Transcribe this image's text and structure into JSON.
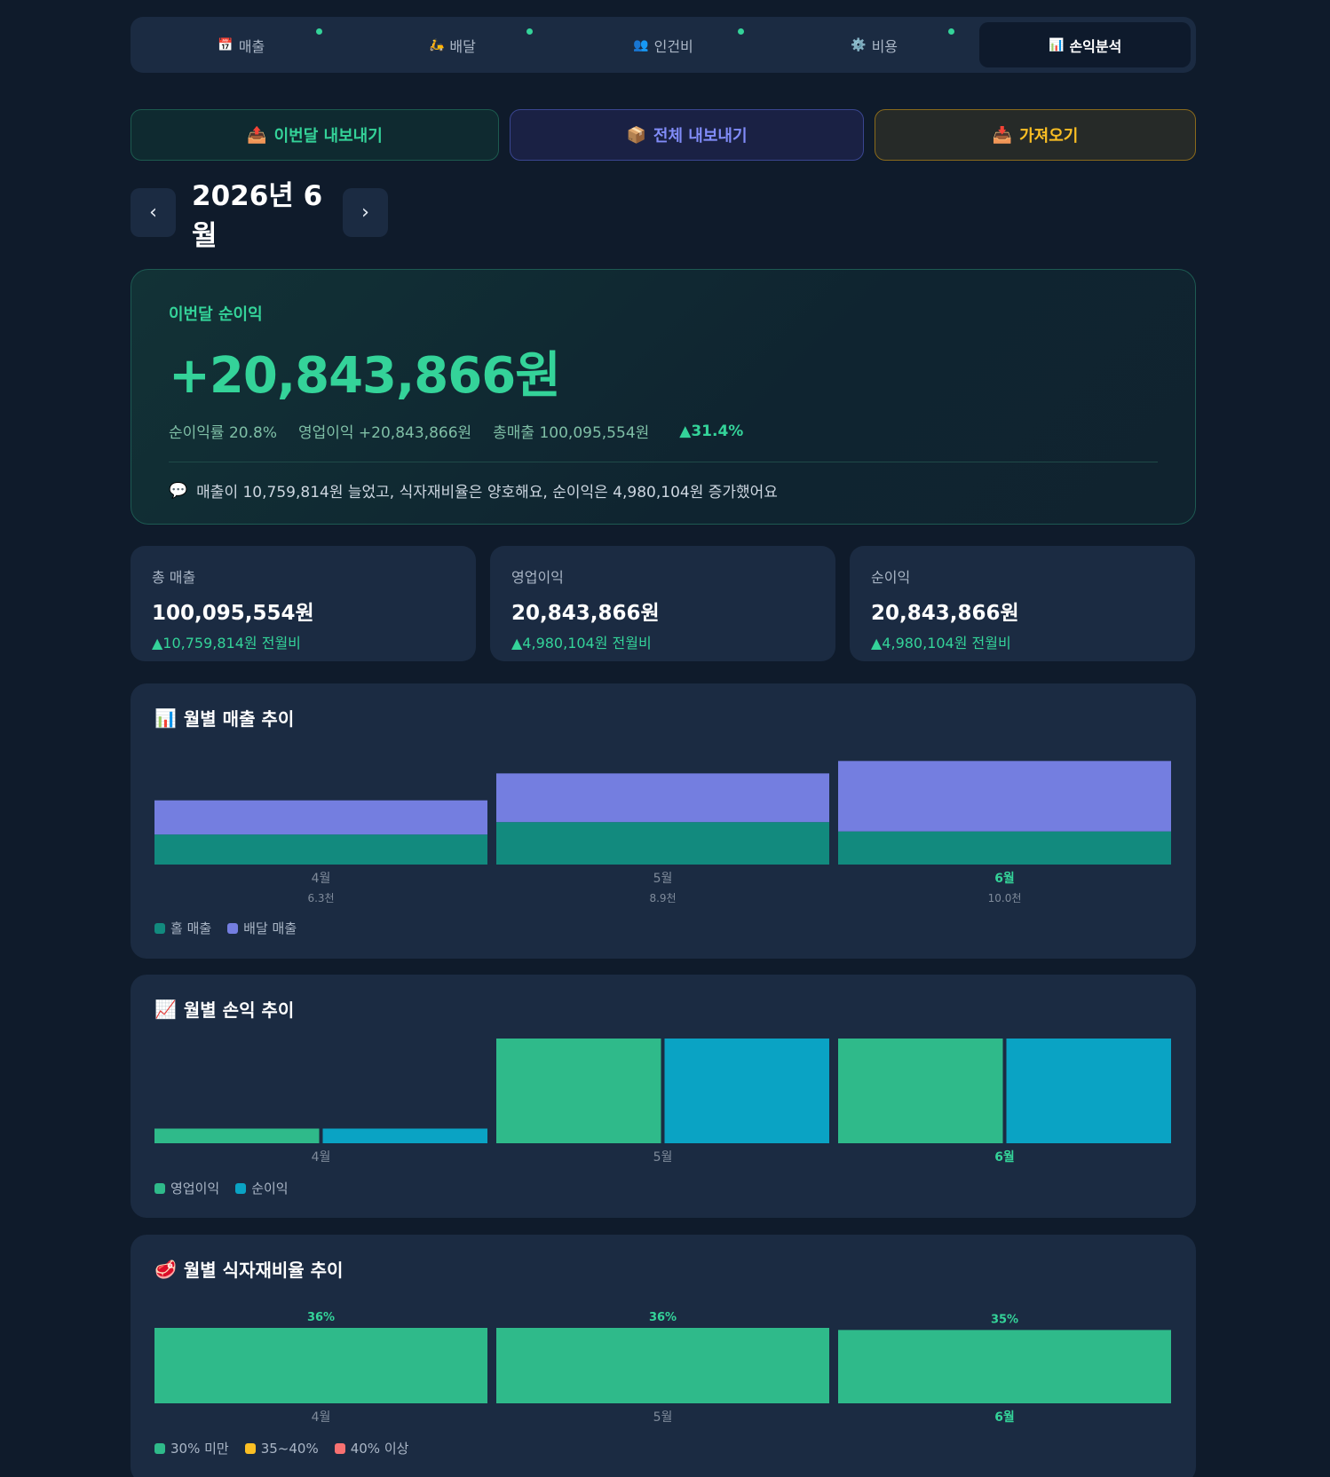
{
  "tabs": [
    {
      "icon": "📅",
      "label": "매출",
      "dot": true,
      "active": false
    },
    {
      "icon": "🛵",
      "label": "배달",
      "dot": true,
      "active": false
    },
    {
      "icon": "👥",
      "label": "인건비",
      "dot": true,
      "active": false
    },
    {
      "icon": "⚙️",
      "label": "비용",
      "dot": true,
      "active": false
    },
    {
      "icon": "📊",
      "label": "손익분석",
      "dot": false,
      "active": true
    }
  ],
  "actions": {
    "export_month": {
      "icon": "📤",
      "label": "이번달 내보내기"
    },
    "export_all": {
      "icon": "📦",
      "label": "전체 내보내기"
    },
    "import": {
      "icon": "📥",
      "label": "가져오기"
    }
  },
  "month_nav": {
    "prev": "‹",
    "current": "2026년 6월",
    "next": "›"
  },
  "hero": {
    "label": "이번달 순이익",
    "value": "+20,843,866원",
    "margin": "순이익률 20.8%",
    "operating": "영업이익 +20,843,866원",
    "revenue": "총매출 100,095,554원",
    "change": "▲31.4%",
    "comment_icon": "💬",
    "comment": "매출이 10,759,814원 늘었고, 식자재비율은 양호해요, 순이익은 4,980,104원 증가했어요"
  },
  "stats": [
    {
      "title": "총 매출",
      "value": "100,095,554원",
      "delta": "▲10,759,814원 전월비"
    },
    {
      "title": "영업이익",
      "value": "20,843,866원",
      "delta": "▲4,980,104원 전월비"
    },
    {
      "title": "순이익",
      "value": "20,843,866원",
      "delta": "▲4,980,104원 전월비"
    }
  ],
  "colors": {
    "hall": "#128a7e",
    "delivery": "#747ee0",
    "operating": "#2fba8a",
    "net": "#0aa3c4",
    "under30": "#2fba8a",
    "mid": "#fbbf24",
    "over40": "#f87171",
    "current_label": "#34d399",
    "muted_label": "#7f8b9b"
  },
  "chart_data": [
    {
      "type": "bar",
      "stacked": true,
      "title_icon": "📊",
      "title": "월별 매출 추이",
      "categories": [
        "4월",
        "5월",
        "6월"
      ],
      "totals": [
        "6.3천",
        "8.9천",
        "10.0천"
      ],
      "current": "6월",
      "series": [
        {
          "name": "홀 매출",
          "values": [
            2.9,
            4.1,
            3.2
          ]
        },
        {
          "name": "배달 매출",
          "values": [
            3.3,
            4.7,
            6.8
          ]
        }
      ]
    },
    {
      "type": "bar",
      "title_icon": "📈",
      "title": "월별 손익 추이",
      "categories": [
        "4월",
        "5월",
        "6월"
      ],
      "current": "6월",
      "series": [
        {
          "name": "영업이익",
          "values": [
            1.4,
            10,
            10
          ]
        },
        {
          "name": "순이익",
          "values": [
            1.4,
            10,
            10
          ]
        }
      ]
    },
    {
      "type": "bar",
      "title_icon": "🥩",
      "title": "월별 식자재비율 추이",
      "categories": [
        "4월",
        "5월",
        "6월"
      ],
      "current": "6월",
      "values": [
        36,
        36,
        35
      ],
      "value_labels": [
        "36%",
        "36%",
        "35%"
      ],
      "legend": [
        "30% 미만",
        "35~40%",
        "40% 이상"
      ]
    }
  ]
}
